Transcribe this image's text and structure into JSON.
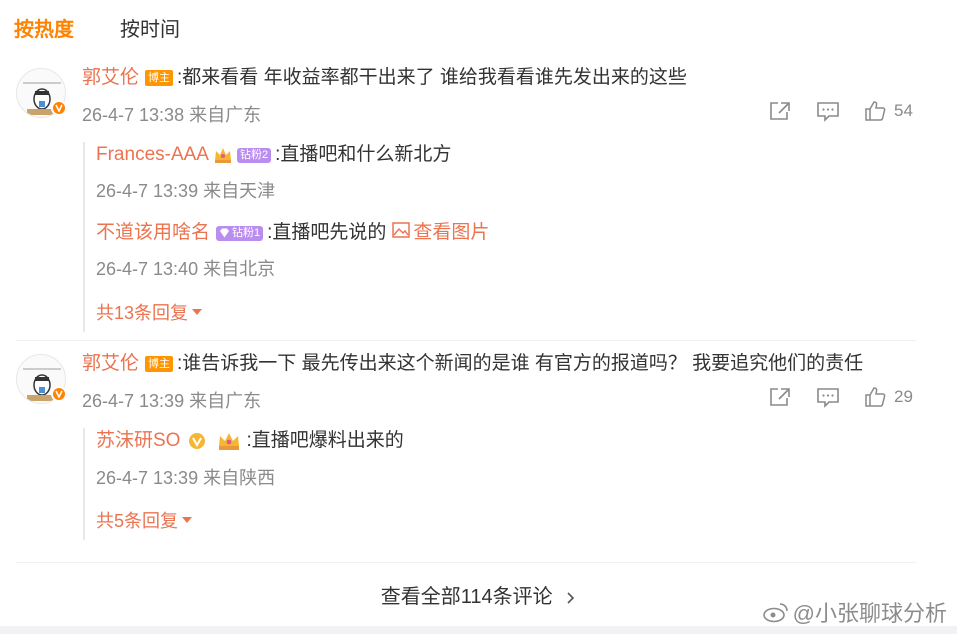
{
  "tabs": {
    "hot": "按热度",
    "time": "按时间"
  },
  "comments": [
    {
      "user": "郭艾伦",
      "host_badge": "博主",
      "text": ":都来看看 年收益率都干出来了 谁给我看看谁先发出来的这些",
      "meta": "26-4-7 13:38 来自广东",
      "likes": "54",
      "replies": [
        {
          "user": "Frances-AAA",
          "fan_badge": "钻粉2",
          "text": ":直播吧和什么新北方",
          "meta": "26-4-7 13:39 来自天津"
        },
        {
          "user": "不道该用啥名",
          "fan_badge": "钻粉1",
          "text": ":直播吧先说的",
          "link": "查看图片",
          "meta": "26-4-7 13:40 来自北京"
        }
      ],
      "more": "共13条回复"
    },
    {
      "user": "郭艾伦",
      "host_badge": "博主",
      "text": ":谁告诉我一下 最先传出来这个新闻的是谁 有官方的报道吗？ 我要追究他们的责任",
      "meta": "26-4-7 13:39 来自广东",
      "likes": "29",
      "replies": [
        {
          "user": "苏沫研SO",
          "text": ":直播吧爆料出来的",
          "meta": "26-4-7 13:39 来自陕西"
        }
      ],
      "more": "共5条回复"
    }
  ],
  "view_all": "查看全部114条评论",
  "watermark": "@小张聊球分析",
  "colors": {
    "accent": "#ff8200",
    "username": "#eb7350",
    "meta": "#8a8a8a"
  }
}
